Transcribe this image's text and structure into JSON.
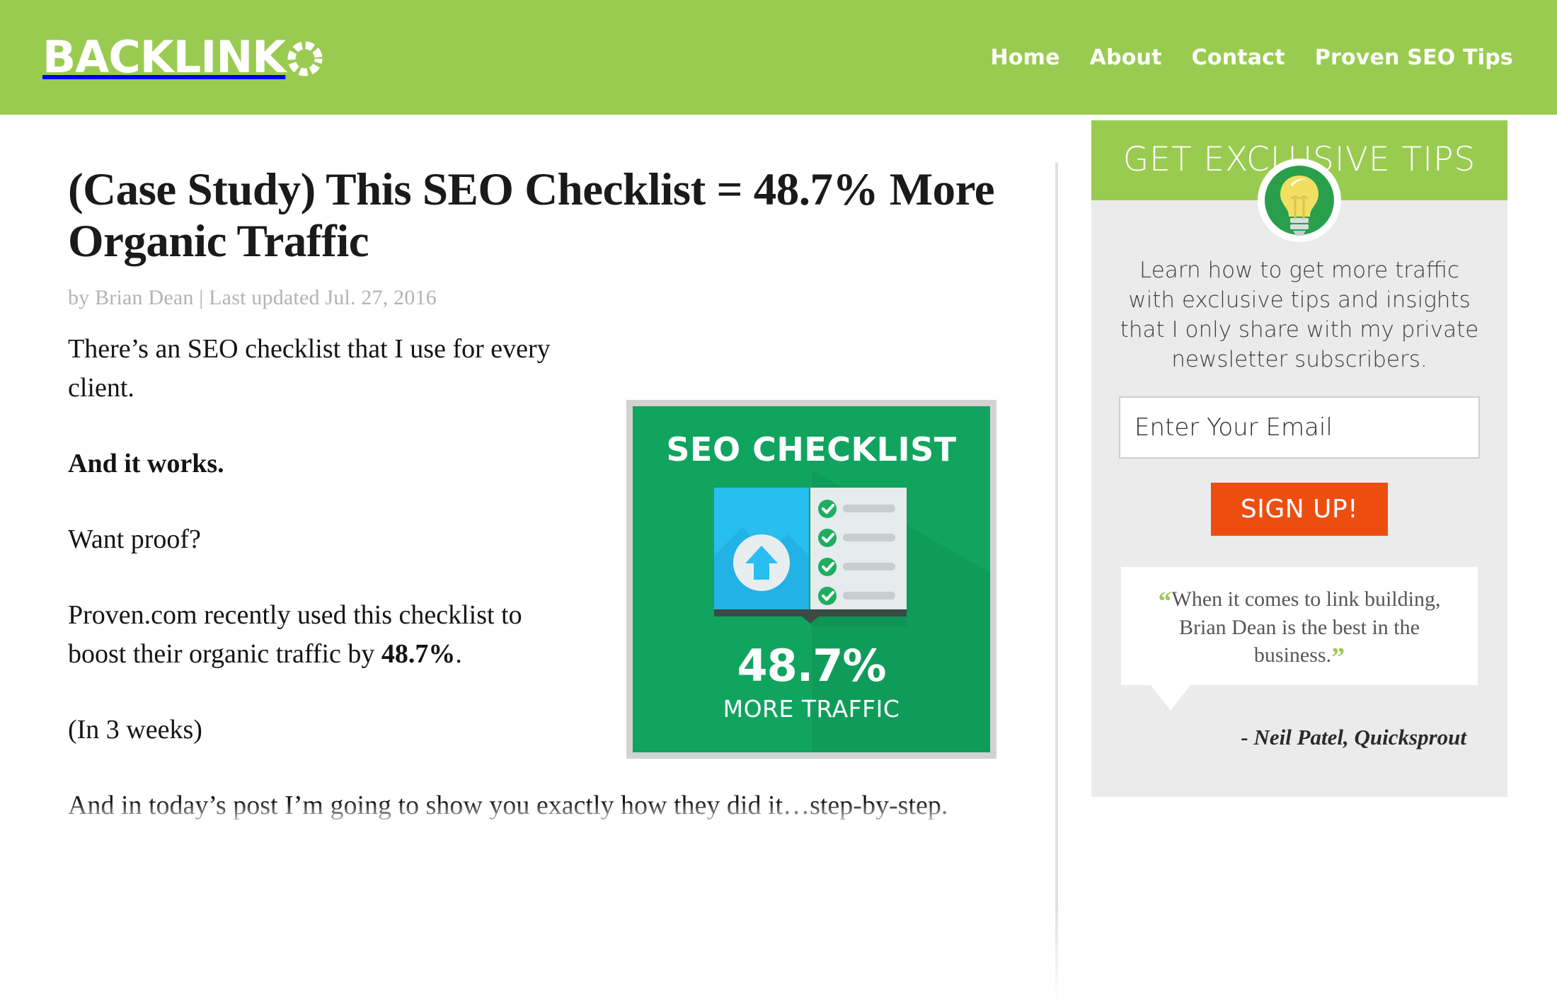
{
  "header": {
    "logo_text": "BACKLINK",
    "logo_ring_icon": "segmented-ring-icon",
    "nav": [
      {
        "label": "Home"
      },
      {
        "label": "About"
      },
      {
        "label": "Contact"
      },
      {
        "label": "Proven SEO Tips"
      }
    ]
  },
  "article": {
    "title": "(Case Study) This SEO Checklist = 48.7% More Organic Traffic",
    "byline": "by Brian Dean | Last updated Jul. 27, 2016",
    "paragraphs": [
      {
        "text": "There’s an SEO checklist that I use for every client."
      },
      {
        "text": "And it works."
      },
      {
        "text": "Want proof?"
      },
      {
        "pre": "Proven.com recently used this checklist to boost their organic traffic by ",
        "strong": "48.7%",
        "post": "."
      },
      {
        "text": "(In 3 weeks)"
      },
      {
        "text": "And in today’s post I’m going to show you exactly how they did it…step-by-step."
      }
    ]
  },
  "featured_image": {
    "title": "SEO CHECKLIST",
    "percent": "48.7%",
    "subtitle": "MORE TRAFFIC",
    "illustration": "checklist-book-icon",
    "bg_color": "#10A45F",
    "page_color": "#29BEF0",
    "check_color": "#1FAE5F"
  },
  "sidebar": {
    "optin": {
      "heading": "GET EXCLUSIVE TIPS",
      "icon": "lightbulb-icon",
      "description": "Learn how to get more traffic with exclusive tips and insights that I only share with my private newsletter subscribers.",
      "email_placeholder": "Enter Your Email",
      "email_value": "",
      "signup_label": "SIGN UP!",
      "signup_color": "#ED4E10",
      "accent_color": "#9ACB51"
    },
    "testimonial": {
      "open_quote": "“",
      "close_quote": "”",
      "quote": "When it comes to link building, Brian Dean is the best in the business.",
      "author": "- Neil Patel, Quicksprout"
    }
  }
}
